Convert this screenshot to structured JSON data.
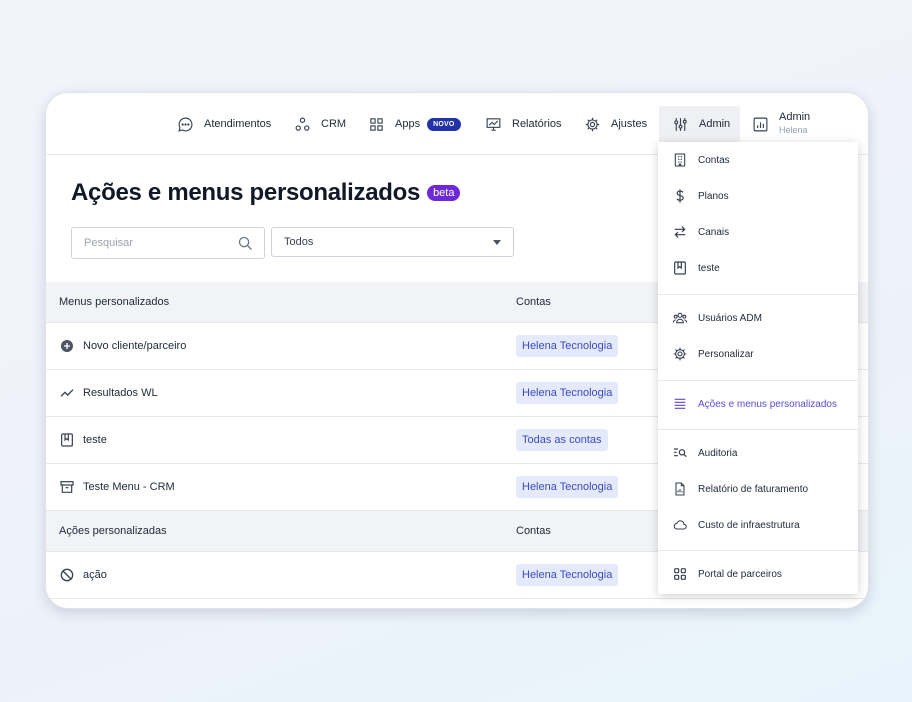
{
  "nav": {
    "atendimentos": "Atendimentos",
    "crm": "CRM",
    "apps": "Apps",
    "apps_badge": "NOVO",
    "relatorios": "Relatórios",
    "ajustes": "Ajustes",
    "admin": "Admin",
    "user_role": "Admin",
    "user_name": "Helena"
  },
  "page": {
    "title": "Ações e menus personalizados",
    "badge": "beta"
  },
  "search": {
    "placeholder": "Pesquisar",
    "value": ""
  },
  "filter": {
    "selected": "Todos"
  },
  "menus_table": {
    "col_name": "Menus personalizados",
    "col_accounts": "Contas",
    "rows": [
      {
        "icon": "plus-circle-icon",
        "name": "Novo cliente/parceiro",
        "accounts": "Helena Tecnologia"
      },
      {
        "icon": "trend-line-icon",
        "name": "Resultados WL",
        "accounts": "Helena Tecnologia"
      },
      {
        "icon": "book-icon",
        "name": "teste",
        "accounts": "Todas as contas"
      },
      {
        "icon": "archive-icon",
        "name": "Teste Menu - CRM",
        "accounts": "Helena Tecnologia"
      }
    ]
  },
  "actions_table": {
    "col_name": "Ações personalizadas",
    "col_accounts": "Contas",
    "rows": [
      {
        "icon": "ban-icon",
        "name": "ação",
        "accounts": "Helena Tecnologia"
      }
    ]
  },
  "admin_menu": {
    "items": [
      {
        "icon": "building-icon",
        "label": "Contas"
      },
      {
        "icon": "dollar-icon",
        "label": "Planos"
      },
      {
        "icon": "arrows-swap-icon",
        "label": "Canais"
      },
      {
        "icon": "book-icon",
        "label": "teste"
      },
      {
        "icon": "users-icon",
        "label": "Usuários ADM"
      },
      {
        "icon": "gear-icon",
        "label": "Personalizar"
      },
      {
        "icon": "list-icon",
        "label": "Ações e menus personalizados",
        "active": true
      },
      {
        "icon": "audit-search-icon",
        "label": "Auditoria"
      },
      {
        "icon": "report-file-icon",
        "label": "Relatório de faturamento"
      },
      {
        "icon": "cloud-icon",
        "label": "Custo de infraestrutura"
      },
      {
        "icon": "grid-icon",
        "label": "Portal de parceiros"
      }
    ]
  },
  "colors": {
    "accent": "#5b4bd6",
    "chip_bg": "#e4e9fb",
    "chip_text": "#3b4cc0",
    "beta_bg": "#6d28d9",
    "novo_bg": "#2233a9"
  }
}
